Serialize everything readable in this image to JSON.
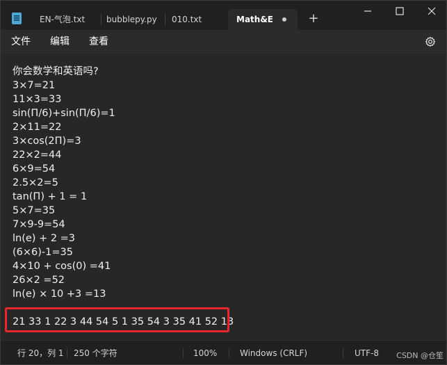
{
  "tabs": [
    {
      "label": "EN-气泡.txt",
      "active": false
    },
    {
      "label": "bubblepy.py",
      "active": false
    },
    {
      "label": "010.txt",
      "active": false
    },
    {
      "label": "Math&En",
      "active": true,
      "unsaved": true
    }
  ],
  "window_controls": {
    "minimize": "minimize-icon",
    "maximize": "maximize-icon",
    "close": "close-icon"
  },
  "menu": {
    "file": "文件",
    "edit": "编辑",
    "view": "查看"
  },
  "editor": {
    "lines": [
      "你会数学和英语吗?",
      "3×7=21",
      "11×3=33",
      "sin(Π/6)+sin(Π/6)=1",
      "2×11=22",
      "3×cos(2Π)=3",
      "22×2=44",
      "6×9=54",
      "2.5×2=5",
      "tan(Π) + 1 = 1",
      "5×7=35",
      "7×9-9=54",
      "ln(e) + 2 =3",
      "(6×6)-1=35",
      "4×10 + cos(0) =41",
      "26×2 =52",
      "ln(e) × 10 +3 =13"
    ],
    "answer_line": "21 33 1 22 3 44 54 5 1 35 54 3 35 41 52 13"
  },
  "status": {
    "position": "行 20，列 1",
    "char_count": "250 个字符",
    "zoom": "100%",
    "line_ending": "Windows (CRLF)",
    "encoding": "UTF-8"
  },
  "watermark": "CSDN @仓笙",
  "colors": {
    "background": "#1f1f1f",
    "editor": "#272727",
    "highlight_border": "#e8262b"
  }
}
